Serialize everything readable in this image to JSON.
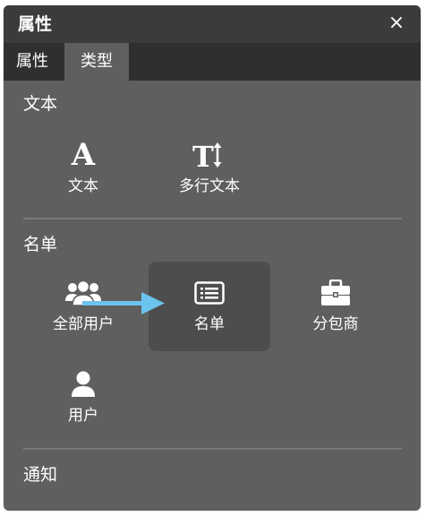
{
  "window": {
    "title": "属性",
    "close_label": "×"
  },
  "tabs": [
    {
      "label": "属性",
      "active": false
    },
    {
      "label": "类型",
      "active": true
    }
  ],
  "sections": [
    {
      "title": "文本",
      "items": [
        {
          "label": "文本",
          "icon": "font-a-icon"
        },
        {
          "label": "多行文本",
          "icon": "multiline-text-icon"
        }
      ]
    },
    {
      "title": "名单",
      "items": [
        {
          "label": "全部用户",
          "icon": "users-group-icon"
        },
        {
          "label": "名单",
          "icon": "list-icon",
          "selected": true
        },
        {
          "label": "分包商",
          "icon": "briefcase-icon"
        },
        {
          "label": "用户",
          "icon": "user-icon"
        }
      ]
    },
    {
      "title": "通知",
      "items": []
    }
  ],
  "colors": {
    "panel_bg": "#5f5f5f",
    "titlebar_bg": "#3b3b3b",
    "tabbar_bg": "#2f2f2f",
    "selected_item_bg": "#4d4d4d",
    "arrow": "#6cc4ee",
    "text": "#ffffff"
  }
}
